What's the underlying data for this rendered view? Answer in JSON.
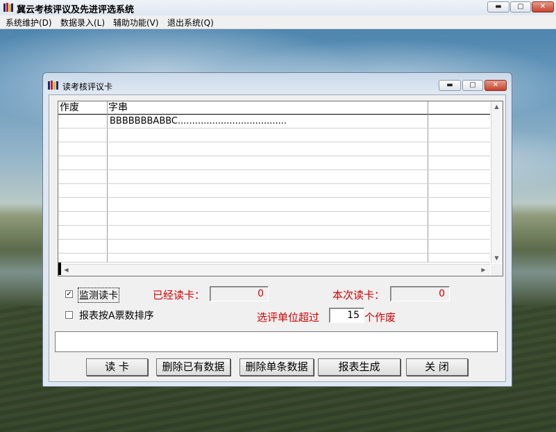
{
  "app": {
    "title": "冀云考核评议及先进评选系统",
    "menus": [
      "系统维护(D)",
      "数据录入(L)",
      "辅助功能(V)",
      "退出系统(Q)"
    ],
    "caption_buttons": {
      "minimize": "▬",
      "maximize": "▢",
      "close": "✕"
    }
  },
  "dialog": {
    "title": "读考核评议卡",
    "grid": {
      "columns": [
        "作废",
        "字串"
      ],
      "rows": [
        {
          "void": "",
          "string": "BBBBBBBABBC......................................"
        }
      ]
    },
    "monitor_checkbox": {
      "label": "监测读卡",
      "checked": true,
      "mark": "✓"
    },
    "sort_checkbox": {
      "label": "报表按A票数排序",
      "checked": false,
      "mark": ""
    },
    "already_read": {
      "label": "已经读卡：",
      "value": "0"
    },
    "this_read": {
      "label": "本次读卡：",
      "value": "0"
    },
    "threshold": {
      "prefix": "选评单位超过",
      "value": "15",
      "suffix": "个作废"
    },
    "memo": "",
    "buttons": {
      "read": "读 卡",
      "delete_all": "删除已有数据",
      "delete_one": "删除单条数据",
      "report": "报表生成",
      "close": "关 闭"
    }
  },
  "colors": {
    "accent_red": "#d40000",
    "window_frame": "#dfe8f2"
  }
}
